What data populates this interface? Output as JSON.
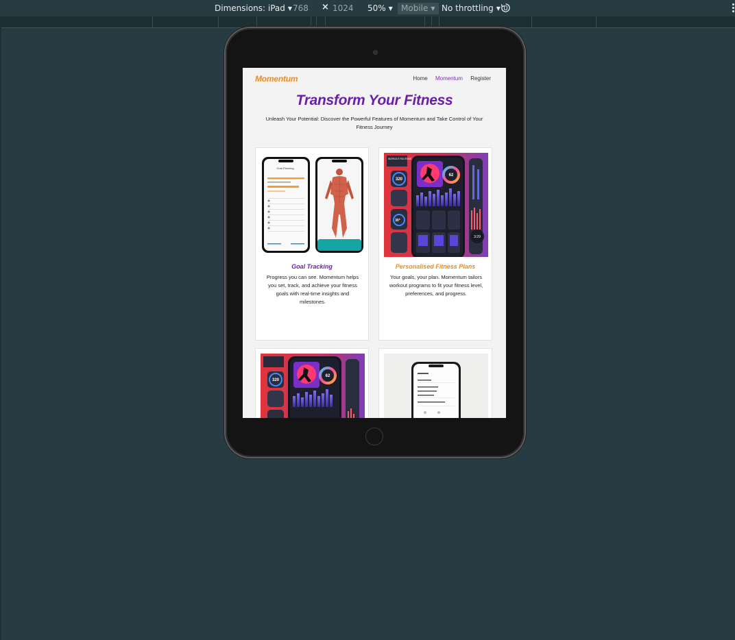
{
  "devtools": {
    "dimensions_label": "Dimensions: iPad",
    "width_value": "768",
    "times": "×",
    "height_value": "1024",
    "zoom": "50%",
    "device_type": "Mobile",
    "throttling": "No throttling"
  },
  "site": {
    "logo": "Momentum",
    "nav": [
      "Home",
      "Momentum",
      "Register"
    ],
    "active_nav": "Momentum",
    "hero_title": "Transform Your Fitness",
    "hero_subtitle": "Unleash Your Potential: Discover the Powerful Features of Momentum and Take Control of Your Fitness Journey",
    "colors": {
      "brand_orange": "#f08a1c",
      "brand_purple": "#6a1fa8",
      "page_bg": "#f3f3f3",
      "canvas_bg": "#263c42"
    },
    "cards": [
      {
        "title": "Goal Tracking",
        "title_color": "#6a1fa8",
        "text": "Progress you can see. Momentum helps you set, track, and achieve your fitness goals with real-time insights and milestones.",
        "image": "goal-tracking-phones-image"
      },
      {
        "title": "Personalised Fitness Plans",
        "title_color": "#f08a1c",
        "text": "Your goals, your plan. Momentum tailors workout programs to fit your fitness level, preferences, and progress.",
        "image": "workout-routines-dashboard-image"
      },
      {
        "title": "",
        "text": "",
        "image": "workout-routines-dashboard-image"
      },
      {
        "title": "",
        "text": "",
        "image": "settings-phone-image"
      }
    ],
    "mock_texts": {
      "goal_screen_title": "Goal Planning",
      "badge_320": "320",
      "badge_30": "30°",
      "badge_62": "62",
      "badge_329": "3:29",
      "routines_label": "WORKOUT ROUTINES"
    }
  }
}
